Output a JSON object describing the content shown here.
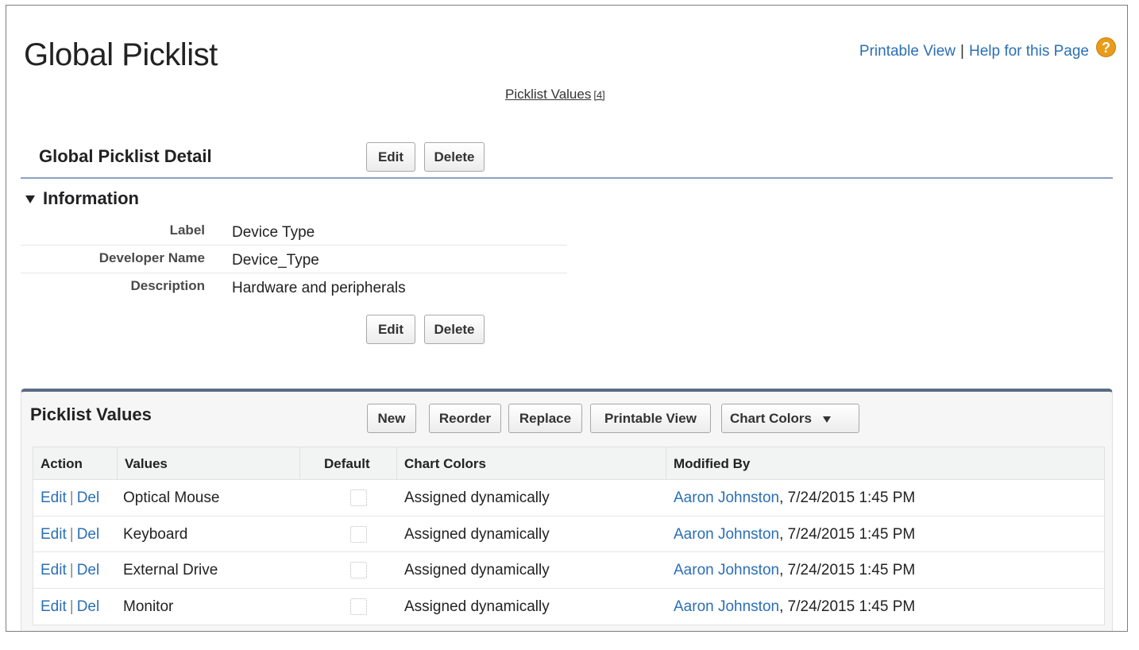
{
  "header": {
    "title": "Global Picklist",
    "printable_view": "Printable View",
    "separator": "|",
    "help_link": "Help for this Page",
    "help_icon": "?"
  },
  "related_list_link": {
    "label": "Picklist Values",
    "count": "[4]"
  },
  "detail": {
    "section_title": "Global Picklist Detail",
    "edit_label": "Edit",
    "delete_label": "Delete",
    "info_title": "Information",
    "fields": [
      {
        "label": "Label",
        "value": "Device Type"
      },
      {
        "label": "Developer Name",
        "value": "Device_Type"
      },
      {
        "label": "Description",
        "value": "Hardware and peripherals"
      }
    ]
  },
  "picklist_values": {
    "title": "Picklist Values",
    "buttons": {
      "new": "New",
      "reorder": "Reorder",
      "replace": "Replace",
      "printable_view": "Printable View",
      "chart_colors": "Chart Colors"
    },
    "columns": [
      "Action",
      "Values",
      "Default",
      "Chart Colors",
      "Modified By"
    ],
    "action_edit": "Edit",
    "action_sep": "|",
    "action_del": "Del",
    "rows": [
      {
        "value": "Optical Mouse",
        "default": false,
        "chart_color": "Assigned dynamically",
        "modified_user": "Aaron Johnston",
        "modified_date": ", 7/24/2015 1:45 PM"
      },
      {
        "value": "Keyboard",
        "default": false,
        "chart_color": "Assigned dynamically",
        "modified_user": "Aaron Johnston",
        "modified_date": ", 7/24/2015 1:45 PM"
      },
      {
        "value": "External Drive",
        "default": false,
        "chart_color": "Assigned dynamically",
        "modified_user": "Aaron Johnston",
        "modified_date": ", 7/24/2015 1:45 PM"
      },
      {
        "value": "Monitor",
        "default": false,
        "chart_color": "Assigned dynamically",
        "modified_user": "Aaron Johnston",
        "modified_date": ", 7/24/2015 1:45 PM"
      }
    ]
  },
  "colors": {
    "link": "#2b6fb5",
    "section_rule": "#8aa1c1",
    "related_list_accent": "#5b6c85",
    "help_icon_bg": "#e99b1a"
  }
}
